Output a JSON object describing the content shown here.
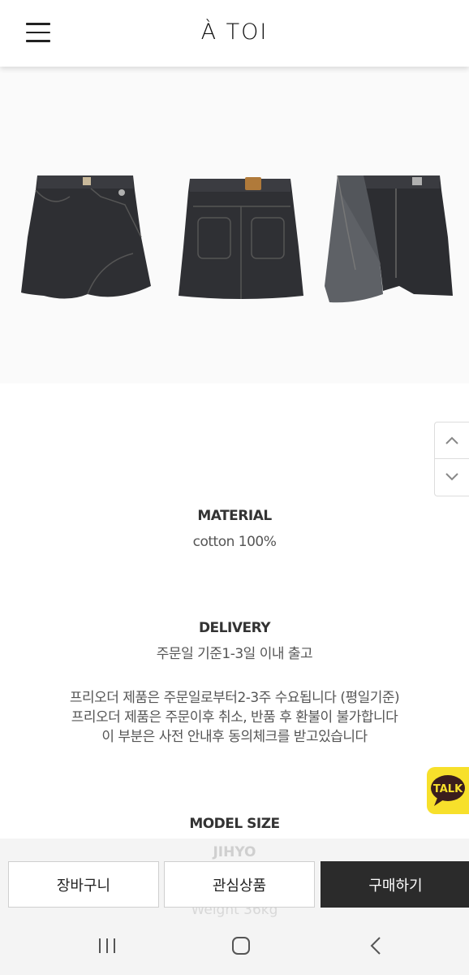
{
  "header": {
    "logo": "À TOI"
  },
  "material": {
    "title": "MATERIAL",
    "text": "cotton 100%"
  },
  "delivery": {
    "title": "DELIVERY",
    "text": "주문일 기준1-3일 이내 출고",
    "notes": [
      "프리오더 제품은 주문일로부터2-3주 수요됩니다 (평일기준)",
      "프리오더 제품은 주문이후 취소, 반품 후 환불이 불가합니다",
      "이 부분은 사전 안내후 동의체크를 받고있습니다"
    ]
  },
  "model_size": {
    "title": "MODEL SIZE",
    "name": "JIHYO",
    "weight": "Weight 36kg"
  },
  "kakao": {
    "label": "TALK"
  },
  "actions": {
    "cart": "장바구니",
    "wishlist": "관심상품",
    "buy": "구매하기"
  },
  "colors": {
    "kakao": "#f7e02b",
    "dark_button": "#2b2b2b"
  }
}
